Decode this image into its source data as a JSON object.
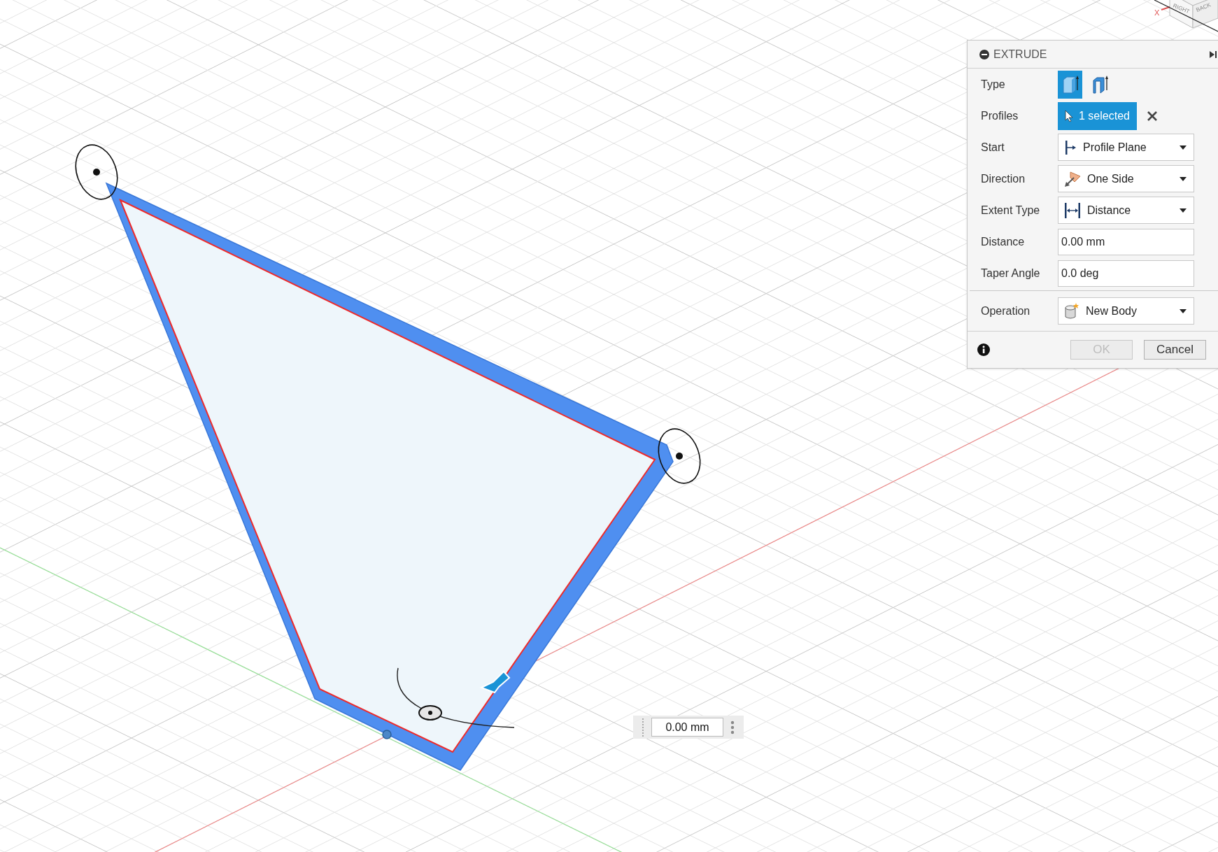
{
  "viewcube": {
    "faces": [
      "RIGHT",
      "BACK"
    ],
    "axis_label": "X"
  },
  "extrude_panel": {
    "title": "EXTRUDE",
    "rows": [
      {
        "label": "Type",
        "kind": "type",
        "options": [
          {
            "selected": true
          },
          {
            "selected": false
          }
        ]
      },
      {
        "label": "Profiles",
        "kind": "selection",
        "value": "1 selected"
      },
      {
        "label": "Start",
        "kind": "dropdown",
        "value": "Profile Plane"
      },
      {
        "label": "Direction",
        "kind": "dropdown",
        "value": "One Side"
      },
      {
        "label": "Extent Type",
        "kind": "dropdown",
        "value": "Distance"
      },
      {
        "label": "Distance",
        "kind": "field",
        "value": "0.00 mm"
      },
      {
        "label": "Taper Angle",
        "kind": "field",
        "value": "0.0 deg"
      }
    ],
    "operation": {
      "label": "Operation",
      "value": "New Body"
    },
    "buttons": [
      {
        "label": "OK",
        "disabled": true
      },
      {
        "label": "Cancel",
        "disabled": false
      }
    ]
  },
  "dimension_input": {
    "value": "0.00 mm"
  }
}
